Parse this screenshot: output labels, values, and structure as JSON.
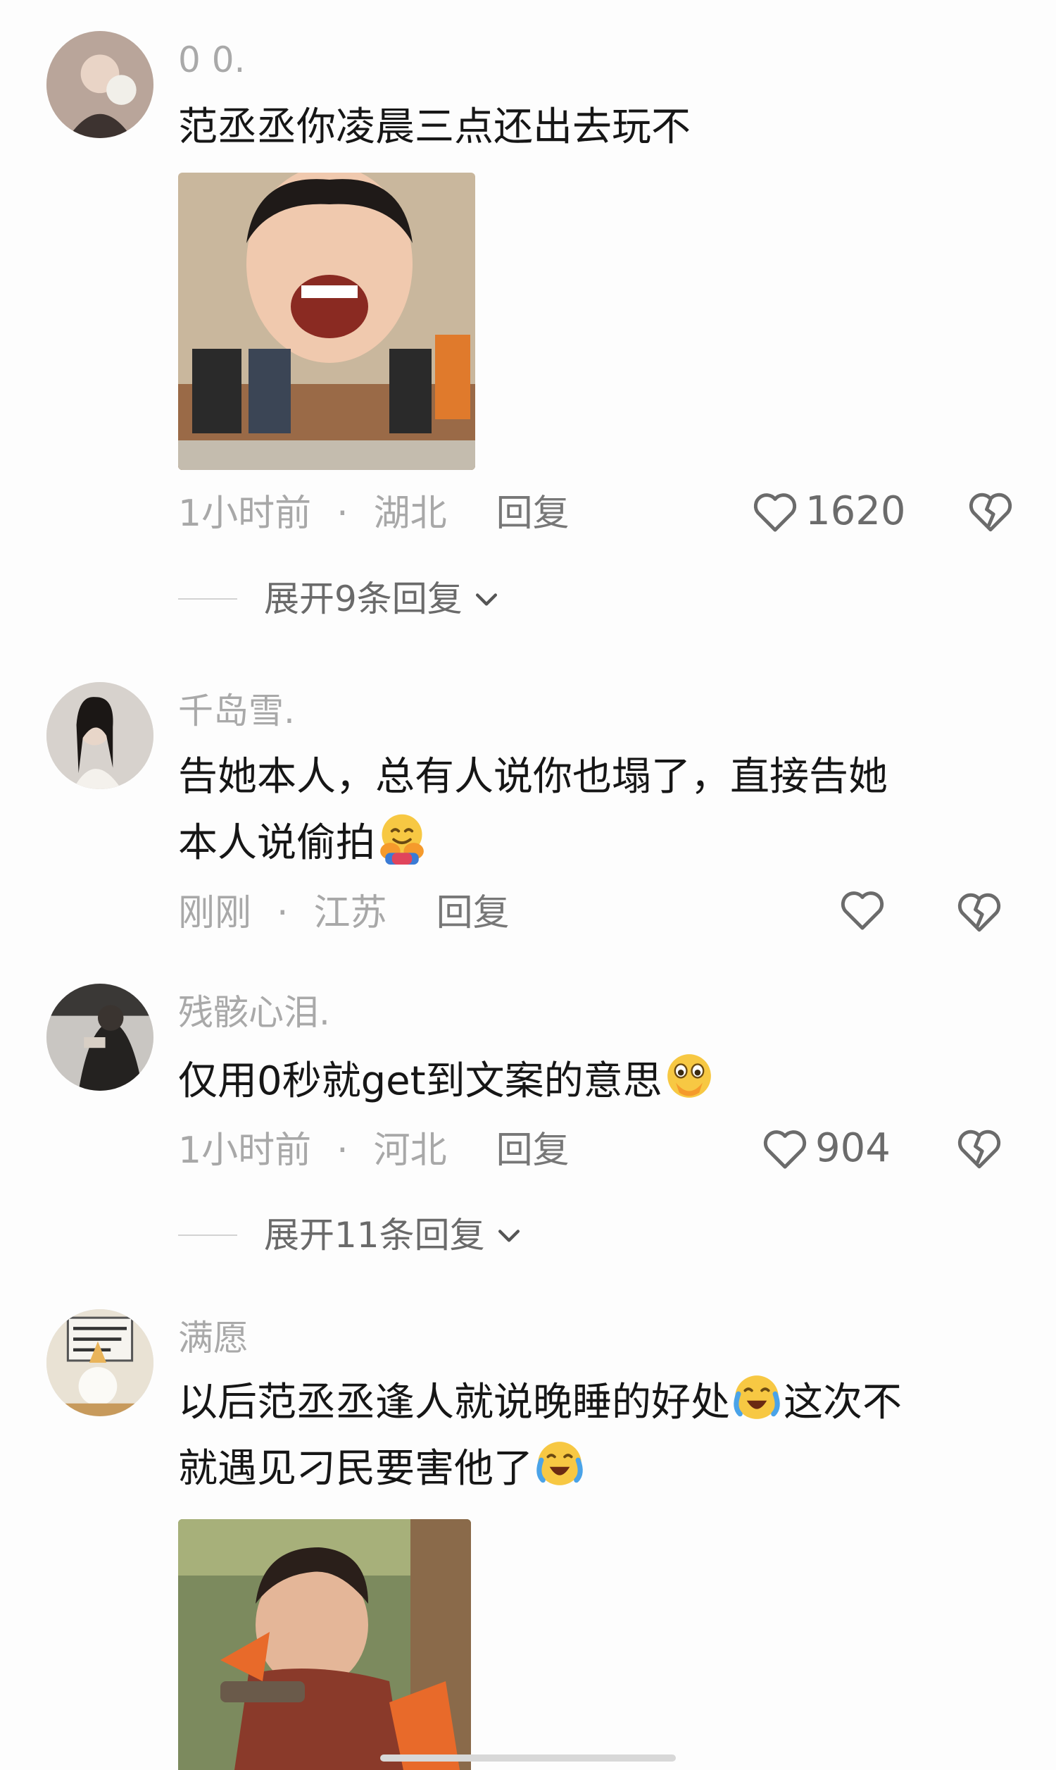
{
  "comments": [
    {
      "username": "0 0.",
      "text": "范丞丞你凌晨三点还出去玩不",
      "has_image": true,
      "time": "1小时前",
      "location": "湖北",
      "reply_label": "回复",
      "likes": "1620",
      "expand_label": "展开9条回复"
    },
    {
      "username": "千岛雪.",
      "text_line1": "告她本人，总有人说你也塌了，直接告她",
      "text_line2": "本人说偷拍",
      "time": "刚刚",
      "location": "江苏",
      "reply_label": "回复",
      "likes": ""
    },
    {
      "username": "残骸心泪.",
      "text": "仅用0秒就get到文案的意思",
      "time": "1小时前",
      "location": "河北",
      "reply_label": "回复",
      "likes": "904",
      "expand_label": "展开11条回复"
    },
    {
      "username": "满愿",
      "text_line1a": "以后范丞丞逢人就说晚睡的好处",
      "text_line1b": "这次不",
      "text_line2": "就遇见刁民要害他了",
      "has_image": true
    }
  ],
  "separator_dot": "·",
  "icons": [
    "heart-outline-icon",
    "broken-heart-icon",
    "chevron-down-icon"
  ],
  "colors": {
    "text": "#161616",
    "muted": "#a8a8a8",
    "action": "#6b6b6b",
    "background": "#fdfdfd"
  }
}
